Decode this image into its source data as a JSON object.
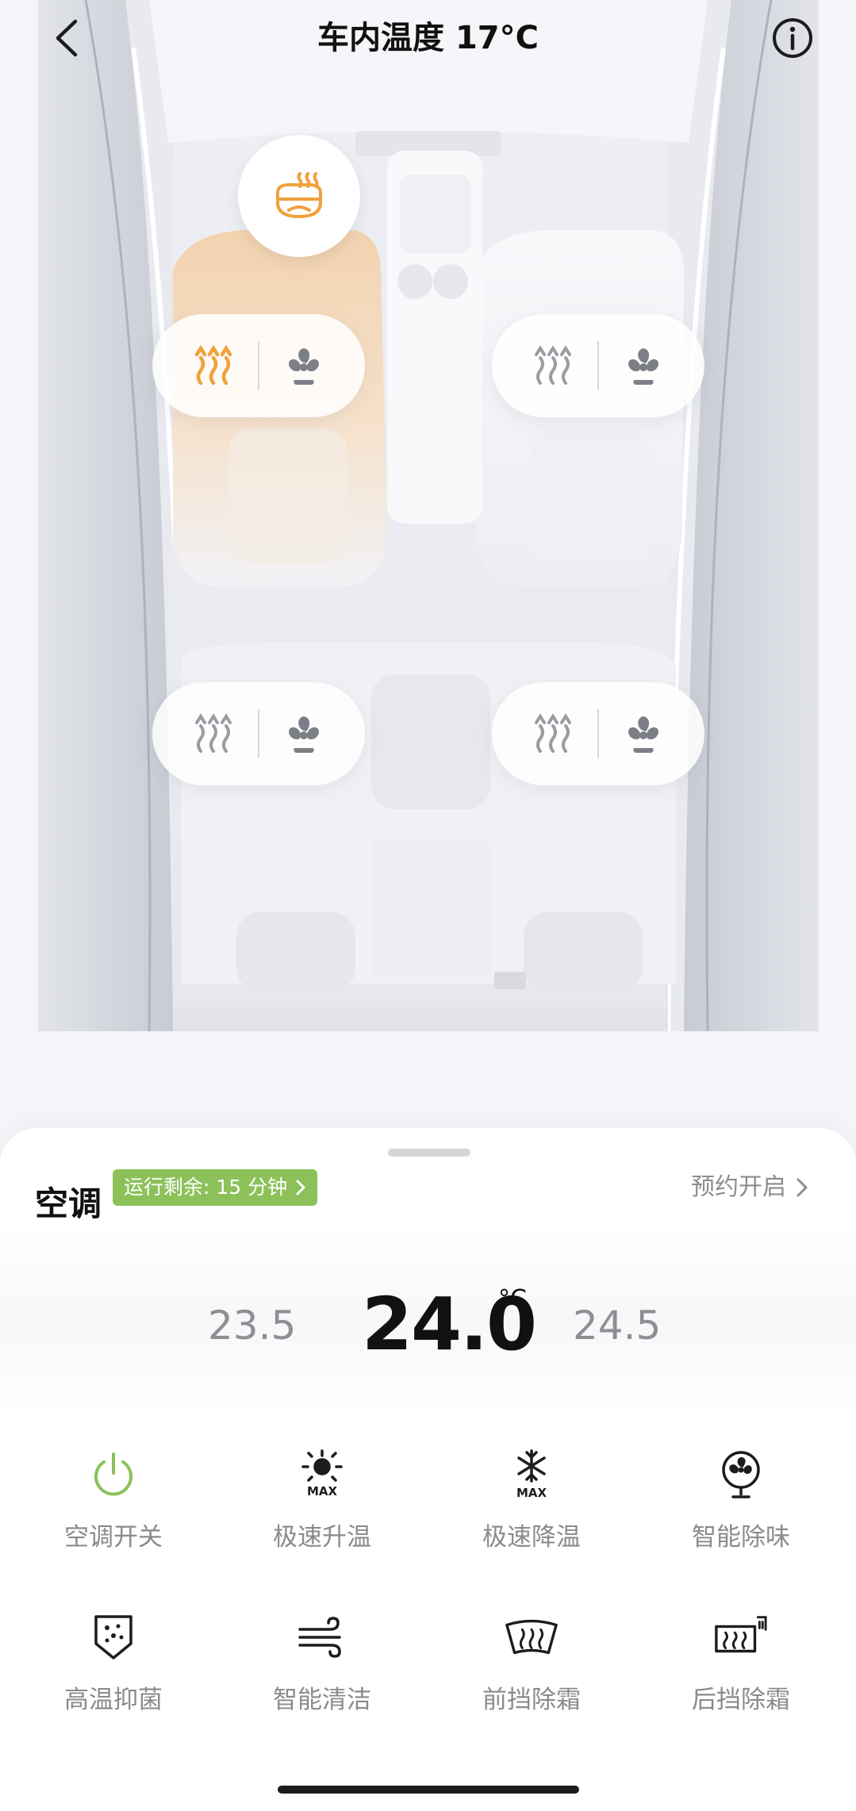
{
  "header": {
    "title": "车内温度 17°C"
  },
  "car": {
    "icons": {
      "heater": "steering-wheel-heat-icon",
      "seat_heat": "seat-heat-icon",
      "seat_fan": "seat-fan-icon"
    },
    "seats": [
      {
        "position": "driver",
        "heat_active": true
      },
      {
        "position": "front-passenger",
        "heat_active": false
      },
      {
        "position": "rear-left",
        "heat_active": false
      },
      {
        "position": "rear-right",
        "heat_active": false
      }
    ],
    "accent_color": "#f0a13c"
  },
  "panel": {
    "ac_title": "空调",
    "runtime_badge": "运行剩余: 15 分钟",
    "runtime_badge_color": "#8cc15a",
    "schedule_label": "预约开启",
    "temp_prev": "23.5",
    "temp_current": "24.0",
    "temp_unit": "°C",
    "temp_next": "24.5"
  },
  "functions": [
    {
      "label": "空调开关",
      "icon": "power-icon"
    },
    {
      "label": "极速升温",
      "icon": "sun-max-icon"
    },
    {
      "label": "极速降温",
      "icon": "snowflake-max-icon"
    },
    {
      "label": "智能除味",
      "icon": "fan-icon"
    },
    {
      "label": "高温抑菌",
      "icon": "shield-dots-icon"
    },
    {
      "label": "智能清洁",
      "icon": "wind-icon"
    },
    {
      "label": "前挡除霜",
      "icon": "front-defrost-icon"
    },
    {
      "label": "后挡除霜",
      "icon": "rear-defrost-icon"
    }
  ]
}
